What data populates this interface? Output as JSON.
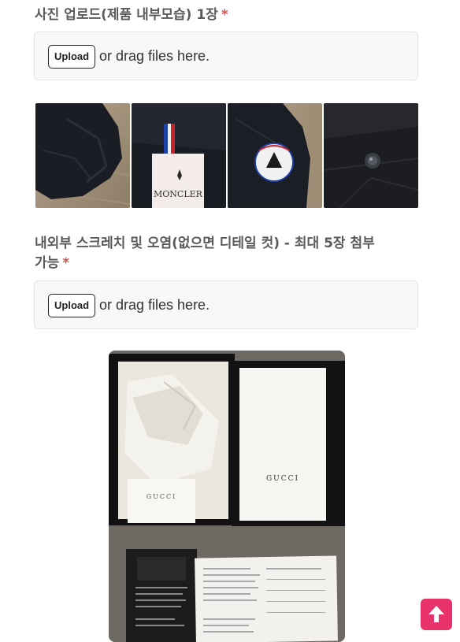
{
  "fields": [
    {
      "label": "사진 업로드(제품 내부모습) 1장",
      "required_mark": "*",
      "upload_label": "Upload",
      "hint": "or drag files here."
    },
    {
      "label_line1": "내외부 스크레치 및 오염(없으면 디테일 컷) - 최대 5장 첨부",
      "label_line2": "가능",
      "required_mark": "*",
      "upload_label": "Upload",
      "hint": "or drag files here."
    }
  ],
  "photo_text": {
    "moncler_tag": "MONCLER",
    "gucci_box": "GUCCI",
    "gucci_card": "GUCCI"
  },
  "scroll_top": {
    "icon": "arrow-up-icon"
  },
  "colors": {
    "required": "#d9534f",
    "accent": "#e8326b"
  }
}
